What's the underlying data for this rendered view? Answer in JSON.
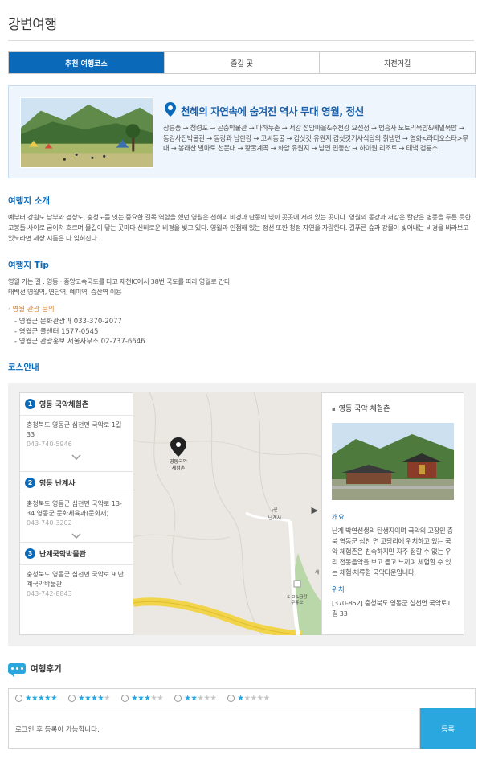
{
  "page": {
    "title": "강변여행"
  },
  "tabs": [
    {
      "label": "추천 여행코스",
      "active": true
    },
    {
      "label": "즐길 곳",
      "active": false
    },
    {
      "label": "자전거길",
      "active": false
    }
  ],
  "featured": {
    "title": "천혜의 자연속에 숨겨진 역사 무대 영월, 정선",
    "route": "장릉풍 → 청령포 → 곤충박물관 → 다하누촌 → 서강 선암마을&주천강 요선정 → 법흥사 도토리묵밥&메밀묵밥 → 동강사진박물관 → 동강과 남한강 → 고씨동굴 → 감삿갓 유원지 감삿갓기사식당의 칡냉면 → 영화<라디오스타>무대 → 봉래산 별마로 천문대 → 황굴계곡 → 화암 유원지 → 남면 민둥산 → 하이원 리조트 → 태백 검룡소"
  },
  "intro": {
    "heading": "여행지 소개",
    "text": "예부터 강원도 남부와 경상도, 충청도를 잇는 중요한 길목 역할을 했던 영월은 천혜의 비경과 단종의 넋이 곳곳에 서려 있는 곳이다. 영월의 동강과 서강은 칼같은 병풍을 두른 듯한 고봉들 사이로 굽이쳐 흐르며 물길이 닿는 곳마다 신비로운 비경을 빚고 있다. 영월과 인접해 있는 정선 또한 청정 자연을 자랑한다. 길푸른 숲과 강물이 빚어내는 비경을 바라보고 있노라면 세상 시름은 다 잊혀진다."
  },
  "tip": {
    "heading": "여행지 Tip",
    "line1": "영월 가는 길 : 영동 · 중앙고속국도를 타고 제천IC에서 38번 국도를 따라 영월로 간다.",
    "line2": "태백선 영월역, 연당역, 예미역, 증산역 이용",
    "inquiry_title": "영월 관광 문의",
    "inquiries": [
      "- 영월군 문화관광과 033-370-2077",
      "- 영월군 콜센터 1577-0545",
      "- 영월군 관광홍보 서울사무소 02-737-6646"
    ]
  },
  "course": {
    "heading": "코스안내",
    "items": [
      {
        "num": "1",
        "name": "영동 국악체험촌",
        "addr": "충청북도 영동군 심천면 국악로 1길 33",
        "phone": "043-740-5946"
      },
      {
        "num": "2",
        "name": "영동 난계사",
        "addr": "충청북도 영동군 심천면 국악로 13-34 영동군 문화체육과(문화재)",
        "phone": "043-740-3202"
      },
      {
        "num": "3",
        "name": "난계국악박물관",
        "addr": "충청북도 영동군 심천면 국악로 9 난계국악박물관",
        "phone": "043-742-8843"
      }
    ],
    "map_labels": {
      "pin": "영동국악 체험촌",
      "temple": "난계사",
      "gas": "S-OIL금강 주유소",
      "edge": "세"
    },
    "next_arrow": "▶",
    "detail": {
      "title": "영동 국악 체험촌",
      "overview_label": "개요",
      "overview": "난계 박연선생의 탄생지이며 국악의 고장인 충북 영동군 심천 면 고당리에 위치하고 있는 국악 체험촌은 친숙하지만 자주 접할 수 없는 우리 전통음악을 보고 듣고 느끼며 체험할 수 있는 체험·체류형 국악타운입니다.",
      "location_label": "위치",
      "location": "[370-852] 충청북도 영동군 심천면 국악로1길 33"
    }
  },
  "review": {
    "heading": "여행후기",
    "ratings": [
      5,
      4,
      3,
      2,
      1
    ],
    "input_placeholder": "로그인 후 등록이 가능합니다.",
    "submit_label": "등록"
  },
  "colors": {
    "primary": "#0a69b8",
    "accent": "#2aa7df",
    "orange": "#d9822b"
  }
}
